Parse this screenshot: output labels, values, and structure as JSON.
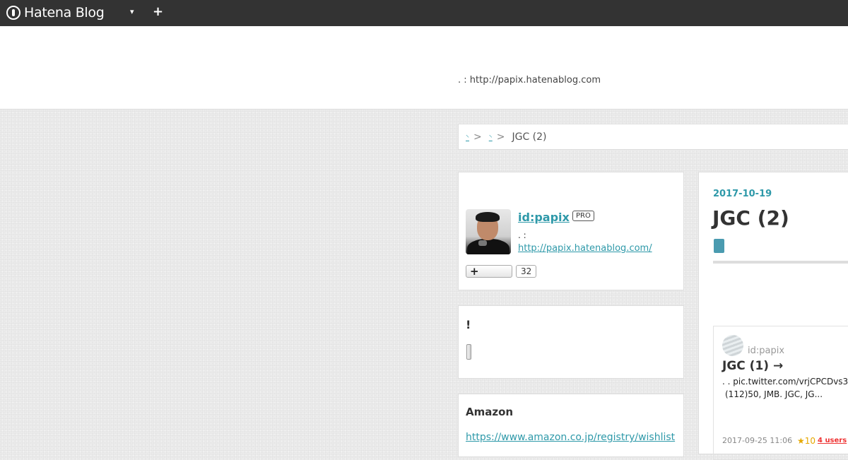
{
  "topbar": {
    "logo_text": "Hatena Blog",
    "dropdown_icon": "▾",
    "add_icon": "+"
  },
  "header": {
    "description": ". : http://papix.hatenablog.com"
  },
  "breadcrumb": {
    "items": [
      "",
      ""
    ],
    "separator": ">",
    "current": "JGC (2)"
  },
  "profile": {
    "id": "id:papix",
    "badge": "PRO",
    "description": ". :",
    "url": "http://papix.hatenablog.com/",
    "follow_icon": "+",
    "follower_count": "32"
  },
  "notice": {
    "title": "!"
  },
  "amazon": {
    "title": "Amazon",
    "link": "https://www.amazon.co.jp/registry/wishlist"
  },
  "article": {
    "date": "2017-10-19",
    "title": "JGC (2)",
    "related": {
      "user": "id:papix",
      "title": "JGC (1) →",
      "excerpt_line1": ". . pic.twitter.com/vrjCPCDvs3",
      "excerpt_line2": "(112)50, JMB. JGC, JG...",
      "time": "2017-09-25 11:06",
      "stars": "★10",
      "bookmarks": "4 users"
    }
  },
  "colors": {
    "accent": "#2e99a9",
    "topbar": "#333333",
    "star": "#e6a800",
    "bookmark": "#ee3333"
  }
}
